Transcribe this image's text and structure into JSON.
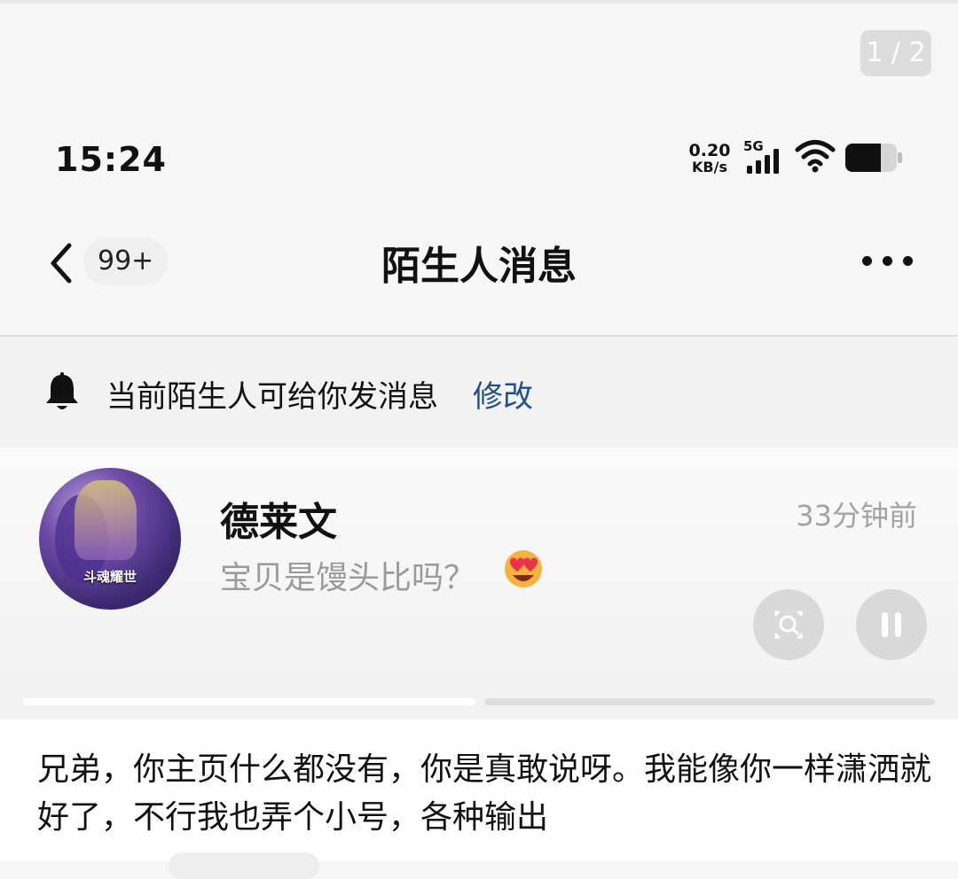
{
  "viewer": {
    "page_counter": "1 / 2"
  },
  "status_bar": {
    "time": "15:24",
    "net_speed_value": "0.20",
    "net_speed_unit": "KB/s",
    "network": "5G",
    "icons": [
      "signal-icon",
      "wifi-icon",
      "battery-icon"
    ]
  },
  "nav": {
    "back_icon": "chevron-left-icon",
    "unread_count": "99+",
    "title": "陌生人消息",
    "more_icon": "more-dots-icon"
  },
  "notice": {
    "icon": "bell-icon",
    "text": "当前陌生人可给你发消息",
    "link": "修改"
  },
  "conversation": {
    "avatar_caption": "斗魂耀世",
    "sender": "德莱文",
    "time": "33分钟前",
    "preview": "宝贝是馒头比吗？",
    "preview_emoji": "heart-eyes-emoji-icon"
  },
  "overlay_buttons": [
    "image-search-icon",
    "pause-icon"
  ],
  "caption": {
    "text": "兄弟，你主页什么都没有，你是真敢说呀。我能像你一样潇洒就好了，不行我也弄个小号，各种输出"
  },
  "colors": {
    "link": "#1f4f8a",
    "muted_text": "#9a9a9a",
    "background": "#f6f6f6"
  }
}
